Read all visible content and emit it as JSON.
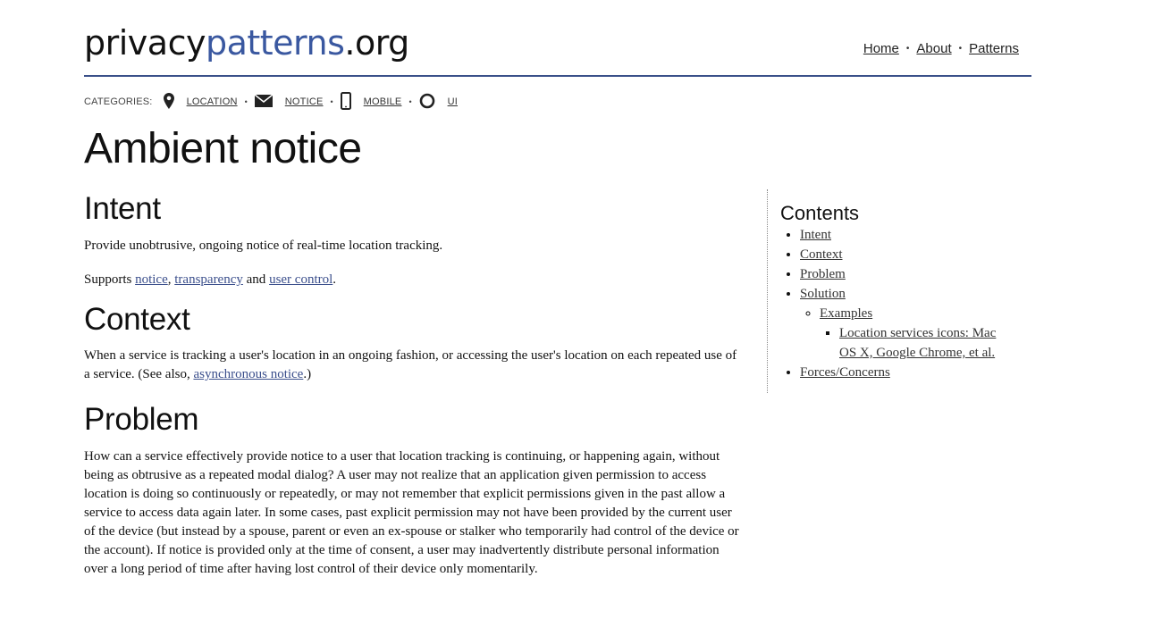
{
  "logo": {
    "part1": "privacy",
    "part2": "patterns",
    "part3": ".org"
  },
  "nav": {
    "items": [
      "Home",
      "About",
      "Patterns"
    ]
  },
  "categories": {
    "label": "CATEGORIES:",
    "items": [
      {
        "label": "LOCATION",
        "icon": "location-pin-icon"
      },
      {
        "label": "NOTICE",
        "icon": "envelope-icon"
      },
      {
        "label": "MOBILE",
        "icon": "mobile-phone-icon"
      },
      {
        "label": "UI",
        "icon": "circle-icon"
      }
    ]
  },
  "page": {
    "title": "Ambient notice"
  },
  "intent": {
    "heading": "Intent",
    "text": "Provide unobtrusive, ongoing notice of real-time location tracking.",
    "supports_prefix": "Supports ",
    "supports_links": [
      "notice",
      "transparency",
      "user control"
    ],
    "comma": ", ",
    "and": " and ",
    "period": "."
  },
  "context": {
    "heading": "Context",
    "text_before": "When a service is tracking a user's location in an ongoing fashion, or accessing the user's location on each repeated use of a service. (See also, ",
    "link": "asynchronous notice",
    "text_after": ".)"
  },
  "problem": {
    "heading": "Problem",
    "text": "How can a service effectively provide notice to a user that location tracking is continuing, or happening again, without being as obtrusive as a repeated modal dialog? A user may not realize that an application given permission to access location is doing so continuously or repeatedly, or may not remember that explicit permissions given in the past allow a service to access data again later. In some cases, past explicit permission may not have been provided by the current user of the device (but instead by a spouse, parent or even an ex-spouse or stalker who temporarily had control of the device or the account). If notice is provided only at the time of consent, a user may inadvertently distribute personal information over a long period of time after having lost control of their device only momentarily."
  },
  "toc": {
    "heading": "Contents",
    "items": [
      "Intent",
      "Context",
      "Problem",
      "Solution",
      "Examples",
      "Location services icons: Mac OS X, Google Chrome, et al.",
      "Forces/Concerns"
    ]
  }
}
